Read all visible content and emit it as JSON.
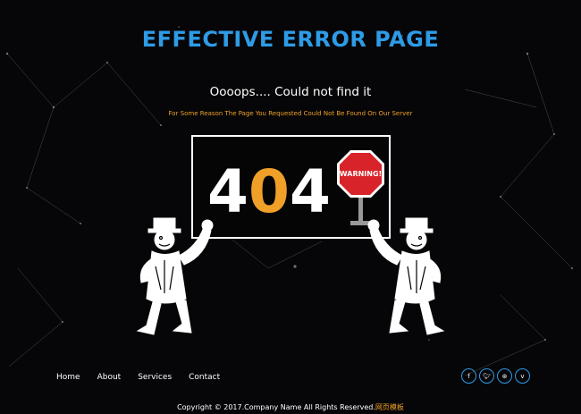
{
  "header": {
    "title": "EFFECTIVE ERROR PAGE"
  },
  "message": {
    "heading": "Oooops.... Could not find it",
    "reason": "For Some Reason The Page You Requested Could Not Be Found On Our Server"
  },
  "sign": {
    "digits": [
      "4",
      "0",
      "4"
    ],
    "warning_text": "WARNING!",
    "colors": {
      "digit": "#ffffff",
      "zero": "#f0a028",
      "warning": "#d9232a"
    }
  },
  "footer": {
    "nav": [
      "Home",
      "About",
      "Services",
      "Contact"
    ],
    "social_icons": [
      "facebook-icon",
      "twitter-icon",
      "dribbble-icon",
      "vimeo-icon"
    ],
    "copyright": "Copyright © 2017.Company Name All Rights Reserved.",
    "copyright_extra": "网页模板"
  },
  "colors": {
    "accent": "#2e9be6",
    "orange": "#f0a028",
    "background": "#060608"
  }
}
